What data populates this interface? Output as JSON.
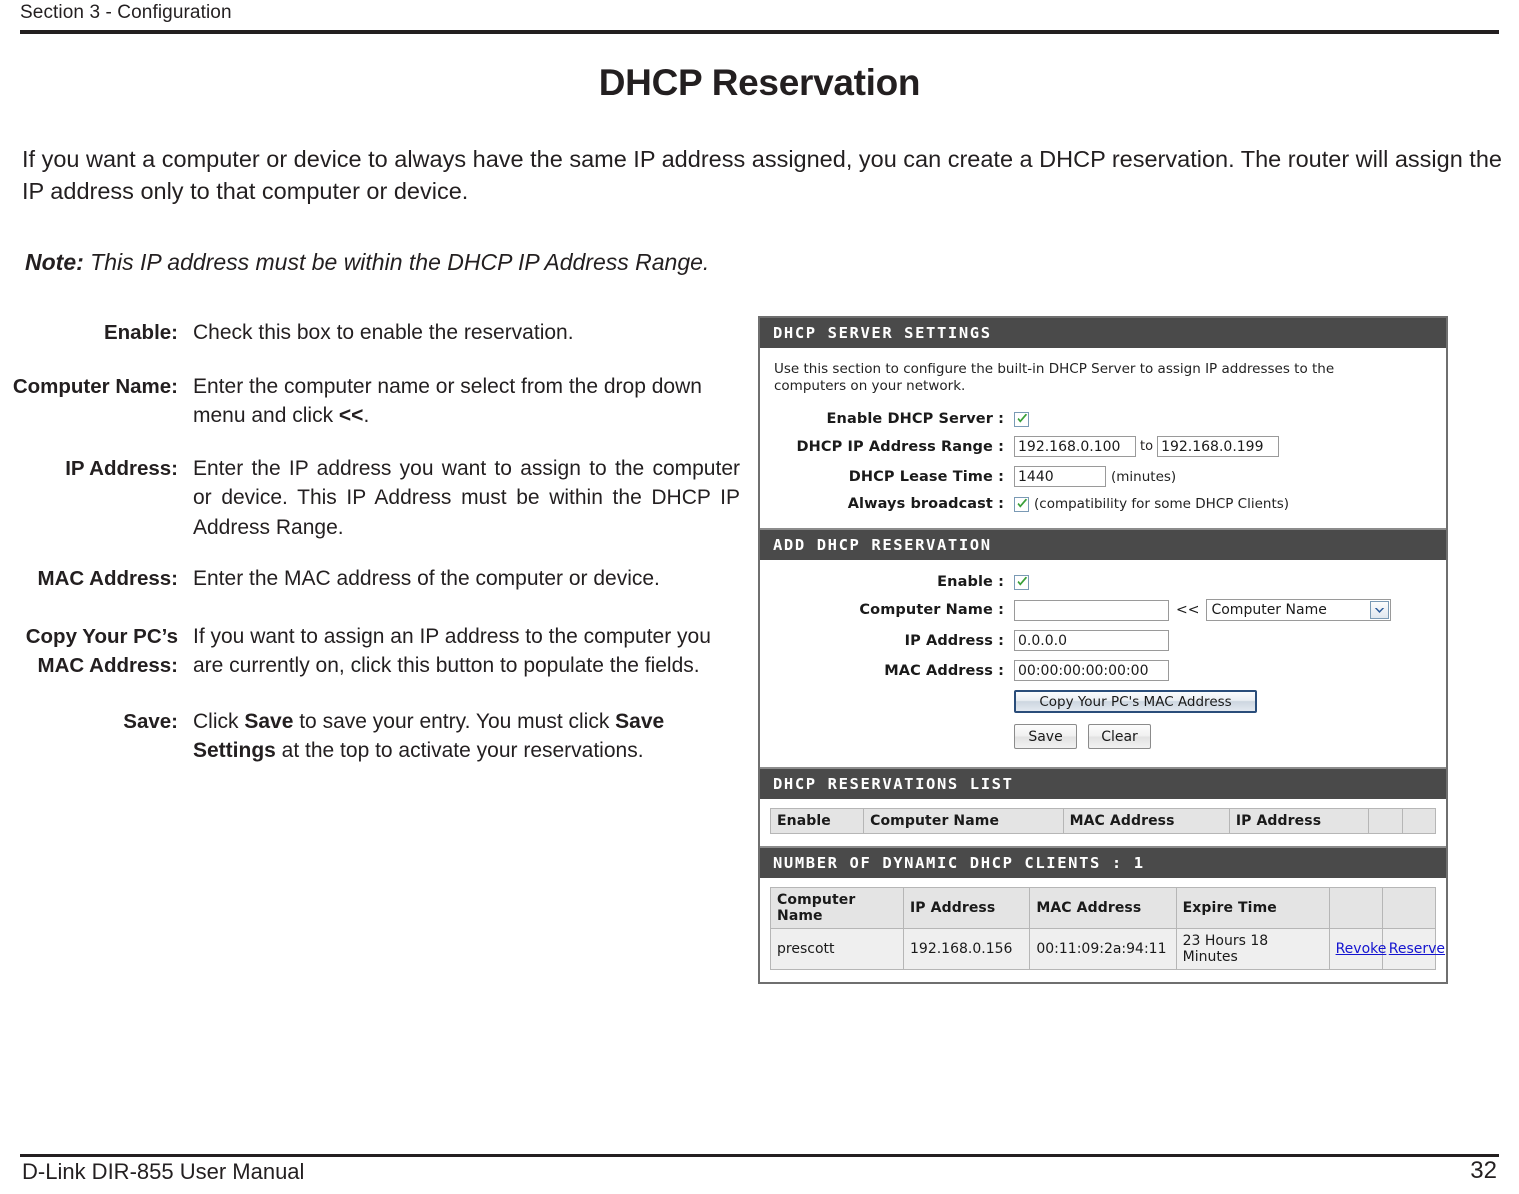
{
  "header": {
    "section": "Section 3 - Configuration"
  },
  "title": "DHCP Reservation",
  "intro": "If you want a computer or device to always have the same IP address assigned, you can create a DHCP reservation. The router will assign the IP address only to that computer or device.",
  "note": {
    "label": "Note:",
    "text": "This IP address must be within the DHCP IP Address Range."
  },
  "descriptions": [
    {
      "label": "Enable:",
      "text": "Check this box to enable the reservation."
    },
    {
      "label": "Computer Name:",
      "text_pre": "Enter the computer name or select from the drop down menu and click ",
      "text_bold": "<<",
      "text_post": "."
    },
    {
      "label": "IP Address:",
      "text": "Enter the IP address you want to assign to the computer or device. This IP Address must be within the DHCP IP Address Range."
    },
    {
      "label": "MAC Address:",
      "text": "Enter the MAC address of the computer or device."
    },
    {
      "label_line1": "Copy Your PC’s",
      "label_line2": "MAC Address:",
      "text": "If you want to assign an IP address to the computer you are currently on, click this button to populate the fields."
    },
    {
      "label": "Save:",
      "text_pre": "Click ",
      "bold1": "Save",
      "text_mid": " to save your entry. You must click ",
      "bold2": "Save Settings",
      "text_post": " at the top to activate your reservations."
    }
  ],
  "router_ui": {
    "dhcp_server_settings": {
      "heading": "DHCP SERVER SETTINGS",
      "blurb": "Use this section to configure the built-in DHCP Server to assign IP addresses to the computers on your network.",
      "enable_label": "Enable DHCP Server :",
      "enable_checked": true,
      "range_label": "DHCP IP Address Range :",
      "range_start": "192.168.0.100",
      "range_to": "to",
      "range_end": "192.168.0.199",
      "lease_label": "DHCP Lease Time :",
      "lease_value": "1440",
      "lease_units": "(minutes)",
      "broadcast_label": "Always broadcast :",
      "broadcast_checked": true,
      "broadcast_hint": "(compatibility for some DHCP Clients)"
    },
    "add_dhcp_reservation": {
      "heading": "ADD DHCP RESERVATION",
      "enable_label": "Enable :",
      "enable_checked": true,
      "computer_name_label": "Computer Name :",
      "computer_name_value": "",
      "lt_symbol": "<<",
      "computer_name_select": "Computer Name",
      "ip_label": "IP Address :",
      "ip_value": "0.0.0.0",
      "mac_label": "MAC Address :",
      "mac_value": "00:00:00:00:00:00",
      "copy_button": "Copy Your PC's MAC Address",
      "save_button": "Save",
      "clear_button": "Clear"
    },
    "reservations_list": {
      "heading": "DHCP RESERVATIONS LIST",
      "columns": [
        "Enable",
        "Computer Name",
        "MAC Address",
        "IP Address",
        "",
        ""
      ],
      "rows": []
    },
    "dynamic_clients": {
      "heading": "NUMBER OF DYNAMIC DHCP CLIENTS : 1",
      "columns": [
        "Computer Name",
        "IP Address",
        "MAC Address",
        "Expire Time",
        "",
        ""
      ],
      "rows": [
        {
          "computer_name": "prescott",
          "ip_address": "192.168.0.156",
          "mac_address": "00:11:09:2a:94:11",
          "expire_time": "23 Hours 18 Minutes",
          "revoke": "Revoke",
          "reserve": "Reserve"
        }
      ]
    }
  },
  "footer": {
    "manual": "D-Link DIR-855 User Manual",
    "page": "32"
  },
  "colors": {
    "panel_header_bg": "#4a4a4a",
    "link": "#1414cf",
    "check_green": "#3aa03a",
    "text": "#231f20"
  }
}
